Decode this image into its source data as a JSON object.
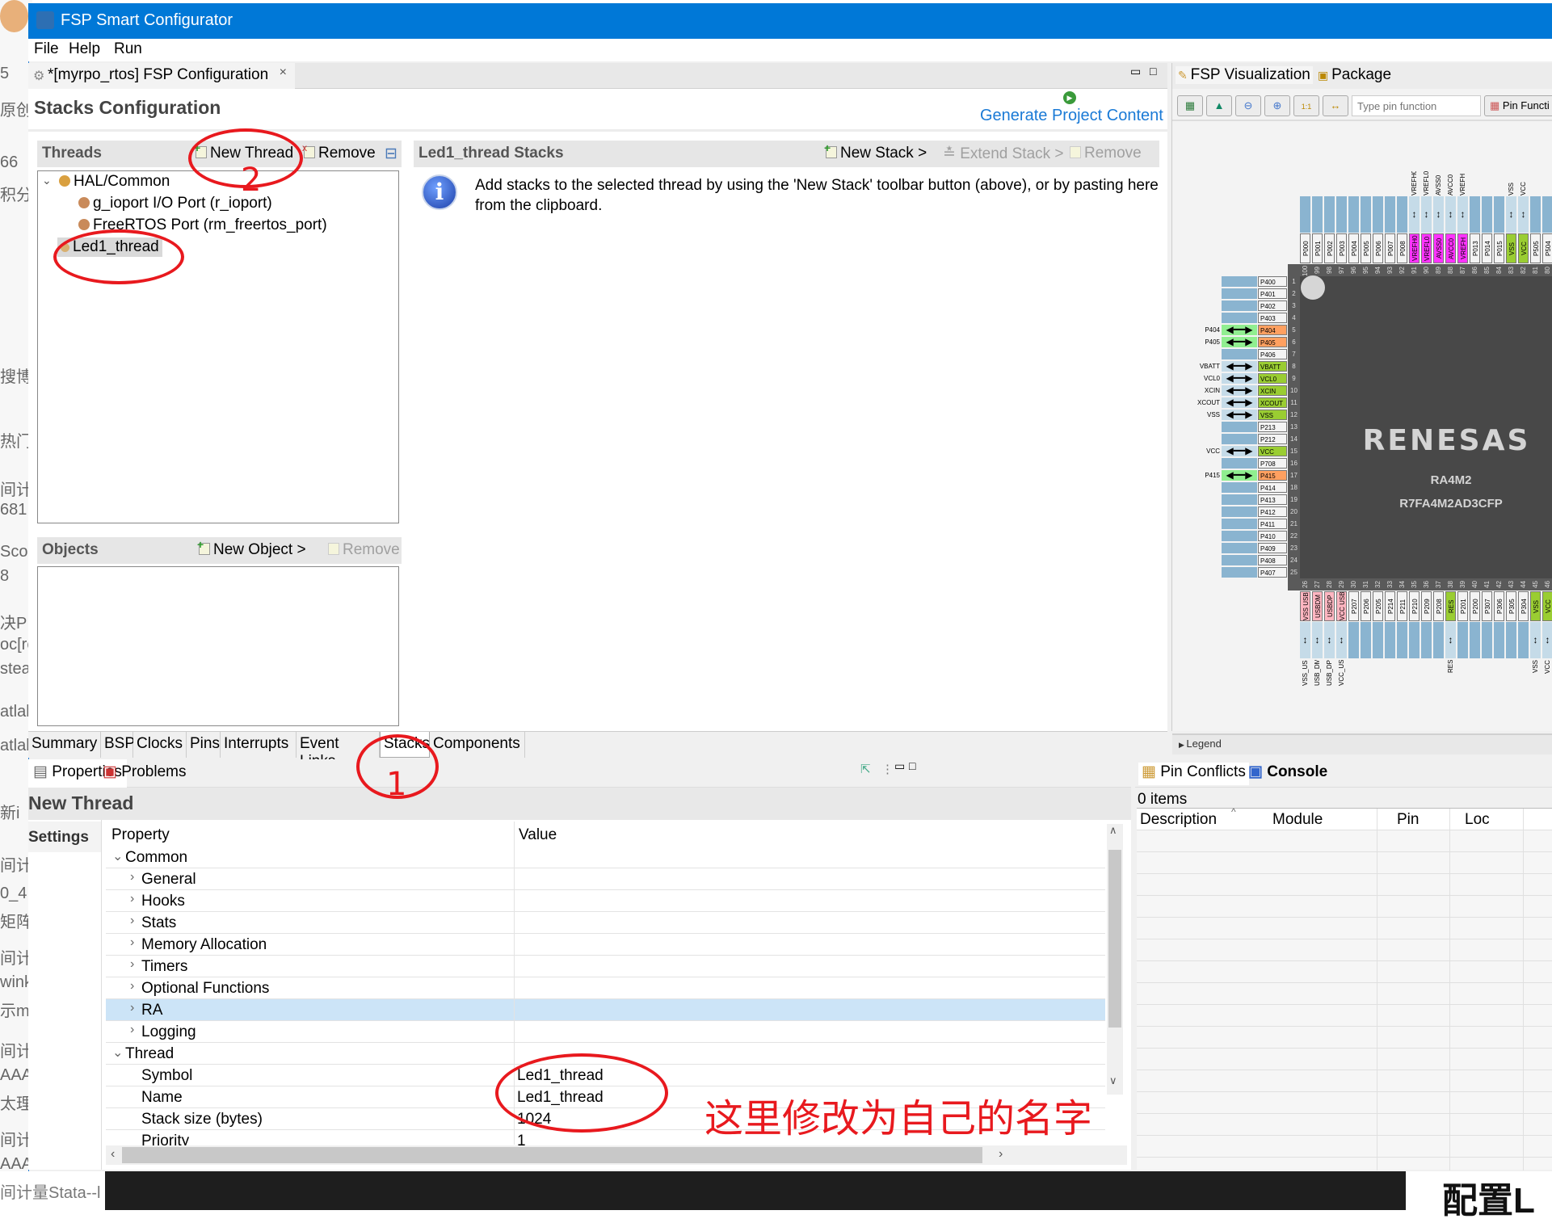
{
  "background_page": {
    "left_fragments": [
      "5",
      "原创",
      "66",
      "积分",
      "搜博",
      "热门文",
      "间计",
      "681",
      "Scoo",
      "8",
      "决P",
      "oc[ro",
      "stea",
      "atlal",
      "atlal",
      "新i",
      "间计",
      "0_4",
      "矩阵",
      "间计",
      "wink",
      "示m",
      "间计",
      "AAA",
      "太理",
      "间计",
      "AAA"
    ],
    "bottom_left_text": "间计量Stata--l",
    "bottom_right_text": "配置L"
  },
  "window": {
    "title": "FSP Smart Configurator",
    "menu": [
      "File",
      "Help",
      "Run"
    ]
  },
  "editor": {
    "tab_label": "*[myrpo_rtos] FSP Configuration",
    "page_title": "Stacks Configuration",
    "generate_label": "Generate Project Content",
    "threads": {
      "title": "Threads",
      "new_thread": "New Thread",
      "remove": "Remove",
      "tree": [
        {
          "label": "HAL/Common",
          "level": 0,
          "expanded": true
        },
        {
          "label": "g_ioport I/O Port (r_ioport)",
          "level": 1
        },
        {
          "label": "FreeRTOS Port (rm_freertos_port)",
          "level": 1
        },
        {
          "label": "Led1_thread",
          "level": 0,
          "selected": true
        }
      ]
    },
    "objects": {
      "title": "Objects",
      "new_object": "New Object >",
      "remove": "Remove"
    },
    "stacks": {
      "title": "Led1_thread Stacks",
      "new_stack": "New Stack >",
      "extend_stack": "Extend Stack >",
      "remove": "Remove",
      "info": "Add stacks to the selected thread by using the 'New Stack' toolbar button (above), or by pasting here from the clipboard."
    },
    "bottom_tabs": [
      "Summary",
      "BSP",
      "Clocks",
      "Pins",
      "Interrupts",
      "Event Links",
      "Stacks",
      "Components"
    ],
    "active_bottom_tab": "Stacks"
  },
  "properties": {
    "tabs": [
      "Properties",
      "Problems"
    ],
    "title": "New Thread",
    "side_tab": "Settings",
    "col_property": "Property",
    "col_value": "Value",
    "rows": [
      {
        "p": "Common",
        "v": "",
        "level": 0,
        "chev": "open"
      },
      {
        "p": "General",
        "v": "",
        "level": 1,
        "chev": "closed"
      },
      {
        "p": "Hooks",
        "v": "",
        "level": 1,
        "chev": "closed"
      },
      {
        "p": "Stats",
        "v": "",
        "level": 1,
        "chev": "closed"
      },
      {
        "p": "Memory Allocation",
        "v": "",
        "level": 1,
        "chev": "closed"
      },
      {
        "p": "Timers",
        "v": "",
        "level": 1,
        "chev": "closed"
      },
      {
        "p": "Optional Functions",
        "v": "",
        "level": 1,
        "chev": "closed"
      },
      {
        "p": "RA",
        "v": "",
        "level": 1,
        "chev": "closed",
        "selected": true
      },
      {
        "p": "Logging",
        "v": "",
        "level": 1,
        "chev": "closed"
      },
      {
        "p": "Thread",
        "v": "",
        "level": 0,
        "chev": "open"
      },
      {
        "p": "Symbol",
        "v": "Led1_thread",
        "level": 1
      },
      {
        "p": "Name",
        "v": "Led1_thread",
        "level": 1
      },
      {
        "p": "Stack size (bytes)",
        "v": "1024",
        "level": 1
      },
      {
        "p": "Priority",
        "v": "1",
        "level": 1
      }
    ]
  },
  "console": {
    "tabs": [
      "Pin Conflicts",
      "Console"
    ],
    "count": "0 items",
    "columns": [
      "Description",
      "Module",
      "Pin",
      "Loc"
    ]
  },
  "visualization": {
    "tabs": [
      "FSP Visualization",
      "Package"
    ],
    "search_placeholder": "Type pin function",
    "pin_functions_label": "Pin Functi",
    "legend": "Legend",
    "chip": {
      "brand": "RENESAS",
      "family": "RA4M2",
      "part": "R7FA4M2AD3CFP",
      "colors": {
        "none": "#f4f4f4",
        "analog": "#ff33ff",
        "power": "#9acd32",
        "gpio_used": "#ffa060",
        "usb": "#ffb6c1",
        "conn": "#8ab4d0",
        "conn_power": "#c5dbe8",
        "conn_used": "#90ee90"
      },
      "top_pins": [
        {
          "n": "100",
          "l": "P000",
          "t": "none"
        },
        {
          "n": "99",
          "l": "P001",
          "t": "none"
        },
        {
          "n": "98",
          "l": "P002",
          "t": "none"
        },
        {
          "n": "97",
          "l": "P003",
          "t": "none"
        },
        {
          "n": "96",
          "l": "P004",
          "t": "none"
        },
        {
          "n": "95",
          "l": "P005",
          "t": "none"
        },
        {
          "n": "94",
          "l": "P006",
          "t": "none"
        },
        {
          "n": "93",
          "l": "P007",
          "t": "none"
        },
        {
          "n": "92",
          "l": "P008",
          "t": "none"
        },
        {
          "n": "91",
          "l": "VREFH0",
          "t": "analog",
          "o": "VREFH0"
        },
        {
          "n": "90",
          "l": "VREFL0",
          "t": "analog",
          "o": "VREFL0"
        },
        {
          "n": "89",
          "l": "AVSS0",
          "t": "analog",
          "o": "AVSS0"
        },
        {
          "n": "88",
          "l": "AVCC0",
          "t": "analog",
          "o": "AVCC0"
        },
        {
          "n": "87",
          "l": "VREFH",
          "t": "analog",
          "o": "VREFH"
        },
        {
          "n": "86",
          "l": "P013",
          "t": "none"
        },
        {
          "n": "85",
          "l": "P014",
          "t": "none"
        },
        {
          "n": "84",
          "l": "P015",
          "t": "none"
        },
        {
          "n": "83",
          "l": "VSS",
          "t": "power",
          "o": "VSS"
        },
        {
          "n": "82",
          "l": "VCC",
          "t": "power",
          "o": "VCC"
        },
        {
          "n": "81",
          "l": "P505",
          "t": "none"
        },
        {
          "n": "80",
          "l": "P504",
          "t": "none"
        }
      ],
      "left_pins": [
        {
          "n": "1",
          "l": "P400",
          "t": "none"
        },
        {
          "n": "2",
          "l": "P401",
          "t": "none"
        },
        {
          "n": "3",
          "l": "P402",
          "t": "none"
        },
        {
          "n": "4",
          "l": "P403",
          "t": "none"
        },
        {
          "n": "5",
          "l": "P404",
          "t": "gpio_used",
          "o": "P404"
        },
        {
          "n": "6",
          "l": "P405",
          "t": "gpio_used",
          "o": "P405"
        },
        {
          "n": "7",
          "l": "P406",
          "t": "none"
        },
        {
          "n": "8",
          "l": "VBATT",
          "t": "power",
          "o": "VBATT"
        },
        {
          "n": "9",
          "l": "VCL0",
          "t": "power",
          "o": "VCL0"
        },
        {
          "n": "10",
          "l": "XCIN",
          "t": "power",
          "o": "XCIN"
        },
        {
          "n": "11",
          "l": "XCOUT",
          "t": "power",
          "o": "XCOUT"
        },
        {
          "n": "12",
          "l": "VSS",
          "t": "power",
          "o": "VSS"
        },
        {
          "n": "13",
          "l": "P213",
          "t": "none"
        },
        {
          "n": "14",
          "l": "P212",
          "t": "none"
        },
        {
          "n": "15",
          "l": "VCC",
          "t": "power",
          "o": "VCC"
        },
        {
          "n": "16",
          "l": "P708",
          "t": "none"
        },
        {
          "n": "17",
          "l": "P415",
          "t": "gpio_used",
          "o": "P415"
        },
        {
          "n": "18",
          "l": "P414",
          "t": "none"
        },
        {
          "n": "19",
          "l": "P413",
          "t": "none"
        },
        {
          "n": "20",
          "l": "P412",
          "t": "none"
        },
        {
          "n": "21",
          "l": "P411",
          "t": "none"
        },
        {
          "n": "22",
          "l": "P410",
          "t": "none"
        },
        {
          "n": "23",
          "l": "P409",
          "t": "none"
        },
        {
          "n": "24",
          "l": "P408",
          "t": "none"
        },
        {
          "n": "25",
          "l": "P407",
          "t": "none"
        }
      ],
      "bottom_pins": [
        {
          "n": "26",
          "l": "VSS USB",
          "t": "usb",
          "o": "VSS_USB"
        },
        {
          "n": "27",
          "l": "USBDM",
          "t": "usb",
          "o": "USB_DM"
        },
        {
          "n": "28",
          "l": "USBDP",
          "t": "usb",
          "o": "USB_DP"
        },
        {
          "n": "29",
          "l": "VCC USB",
          "t": "usb",
          "o": "VCC_USB"
        },
        {
          "n": "30",
          "l": "P207",
          "t": "none"
        },
        {
          "n": "31",
          "l": "P206",
          "t": "none"
        },
        {
          "n": "32",
          "l": "P205",
          "t": "none"
        },
        {
          "n": "33",
          "l": "P214",
          "t": "none"
        },
        {
          "n": "34",
          "l": "P211",
          "t": "none"
        },
        {
          "n": "35",
          "l": "P210",
          "t": "none"
        },
        {
          "n": "36",
          "l": "P209",
          "t": "none"
        },
        {
          "n": "37",
          "l": "P208",
          "t": "none"
        },
        {
          "n": "38",
          "l": "RES",
          "t": "power",
          "o": "RES"
        },
        {
          "n": "39",
          "l": "P201",
          "t": "none"
        },
        {
          "n": "40",
          "l": "P200",
          "t": "none"
        },
        {
          "n": "41",
          "l": "P307",
          "t": "none"
        },
        {
          "n": "42",
          "l": "P306",
          "t": "none"
        },
        {
          "n": "43",
          "l": "P305",
          "t": "none"
        },
        {
          "n": "44",
          "l": "P304",
          "t": "none"
        },
        {
          "n": "45",
          "l": "VSS",
          "t": "power",
          "o": "VSS"
        },
        {
          "n": "46",
          "l": "VCC",
          "t": "power",
          "o": "VCC"
        }
      ]
    }
  },
  "annotations": {
    "step1": "1",
    "step2": "2",
    "note": "这里修改为自己的名字",
    "color": "#e8191e"
  }
}
